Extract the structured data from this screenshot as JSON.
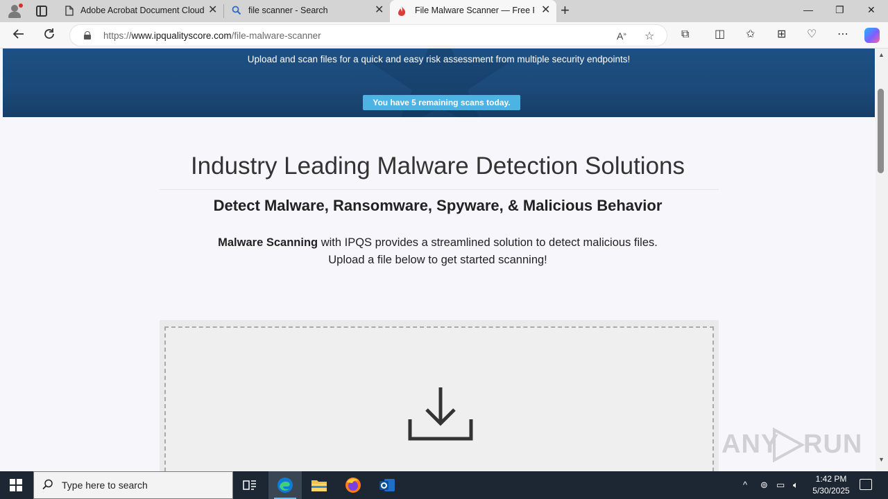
{
  "browser": {
    "tabs": [
      {
        "title": "Adobe Acrobat Document Cloud",
        "icon": "page-icon"
      },
      {
        "title": "file scanner - Search",
        "icon": "search-icon"
      },
      {
        "title": "File Malware Scanner — Free File",
        "icon": "ipqs-flame-icon",
        "active": true
      }
    ],
    "url_prefix": "https://",
    "url_host": "www.ipqualityscore.com",
    "url_path": "/file-malware-scanner"
  },
  "hero": {
    "subtitle": "Upload and scan files for a quick and easy risk assessment from multiple security endpoints!",
    "scans_badge": "You have 5 remaining scans today."
  },
  "content": {
    "heading": "Industry Leading Malware Detection Solutions",
    "subheading": "Detect Malware, Ransomware, Spyware, & Malicious Behavior",
    "intro_bold": "Malware Scanning",
    "intro_rest": " with IPQS provides a streamlined solution to detect malicious files.",
    "intro_line2": "Upload a file below to get started scanning!"
  },
  "watermark": {
    "left": "ANY",
    "right": "RUN"
  },
  "taskbar": {
    "search_placeholder": "Type here to search",
    "time": "1:42 PM",
    "date": "5/30/2025"
  },
  "colors": {
    "hero_bg": "#1d5083",
    "badge_bg": "#4db3e3",
    "taskbar_bg": "#1d2733"
  }
}
